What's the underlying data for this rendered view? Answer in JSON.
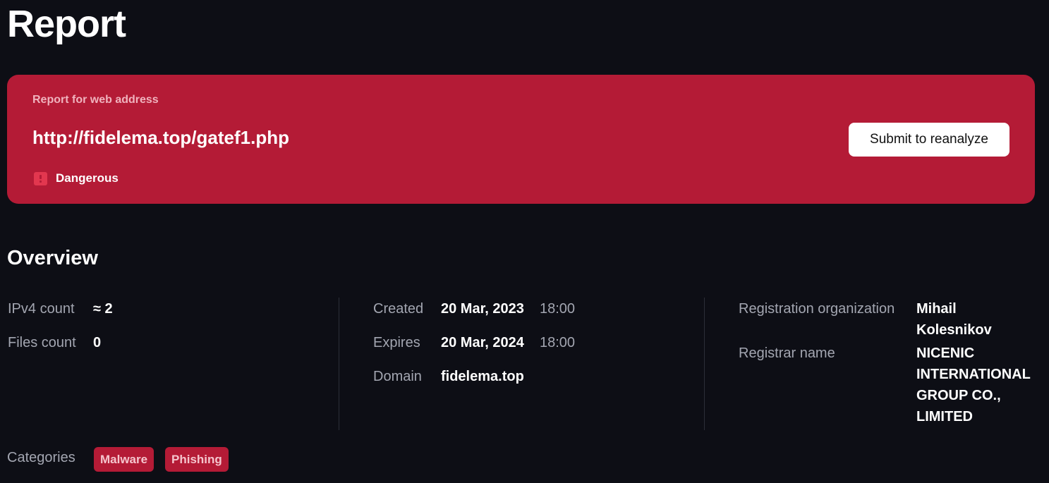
{
  "page": {
    "title": "Report"
  },
  "report_card": {
    "caption": "Report for web address",
    "url": "http://fidelema.top/gatef1.php",
    "verdict": "Dangerous",
    "verdict_icon": "danger-icon",
    "reanalyze_label": "Submit to reanalyze",
    "accent_color": "#b41b36"
  },
  "overview": {
    "title": "Overview",
    "ipv4_count": {
      "label": "IPv4 count",
      "value": "≈ 2"
    },
    "files_count": {
      "label": "Files count",
      "value": "0"
    },
    "created": {
      "label": "Created",
      "date": "20 Mar, 2023",
      "time": "18:00"
    },
    "expires": {
      "label": "Expires",
      "date": "20 Mar, 2024",
      "time": "18:00"
    },
    "domain": {
      "label": "Domain",
      "value": "fidelema.top"
    },
    "registration_organization": {
      "label": "Registration organization",
      "value": "Mihail Kolesnikov"
    },
    "registrar_name": {
      "label": "Registrar name",
      "value": "NICENIC INTERNATIONAL GROUP CO., LIMITED"
    }
  },
  "categories": {
    "label": "Categories",
    "items": [
      "Malware",
      "Phishing"
    ]
  }
}
